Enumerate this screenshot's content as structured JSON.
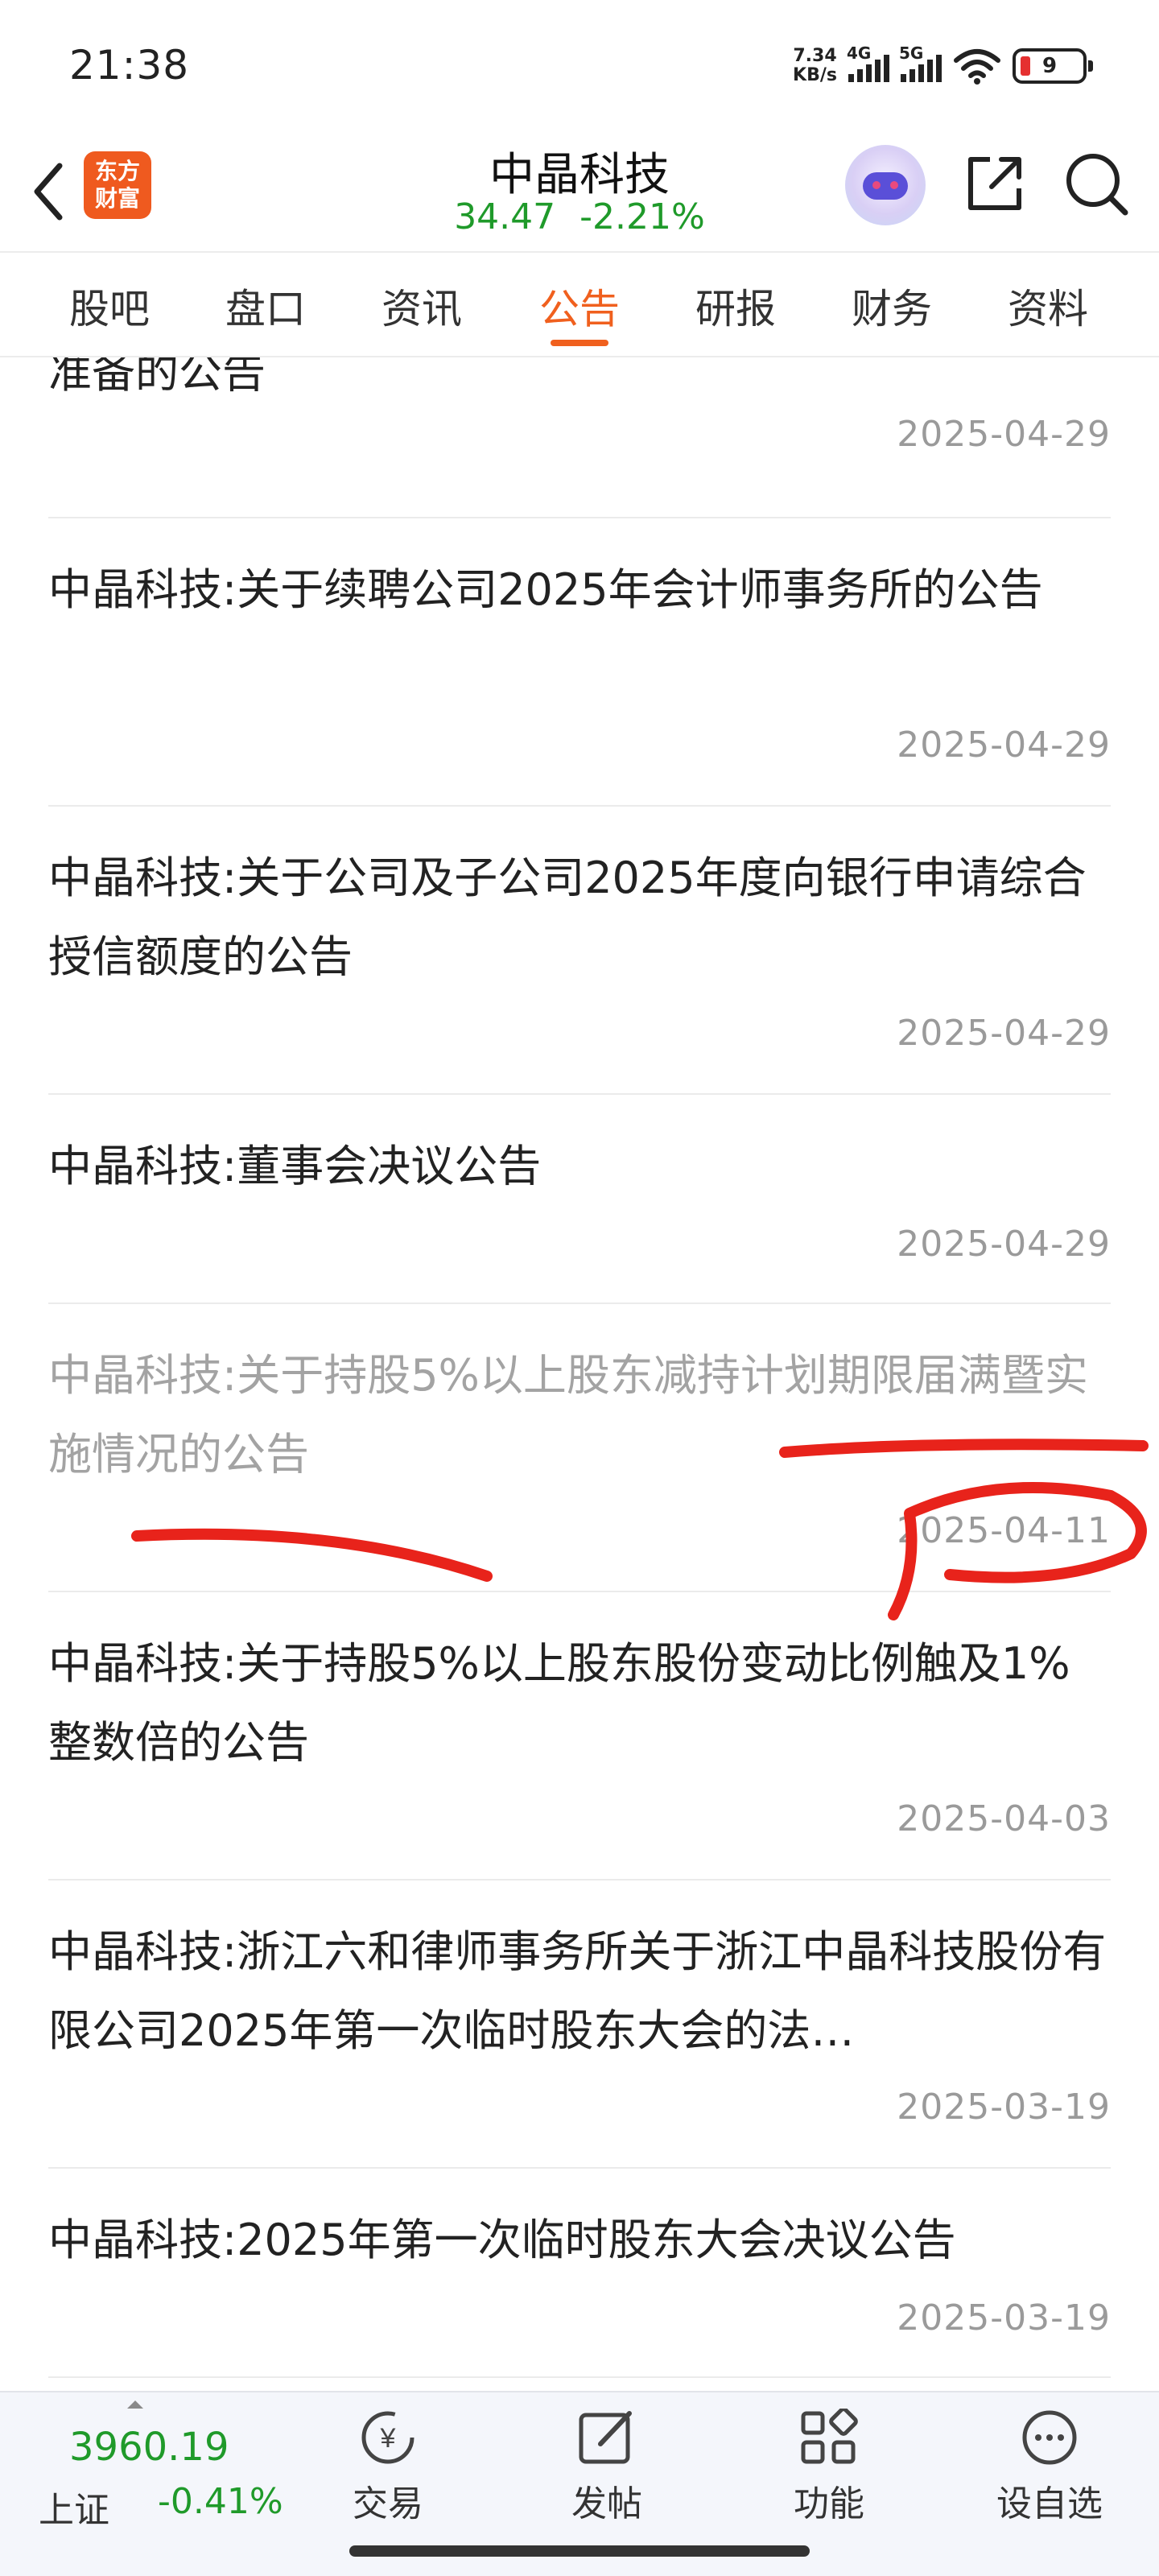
{
  "status": {
    "time": "21:38",
    "net_speed_value": "7.34",
    "net_speed_unit": "KB/s",
    "signal1_label": "4G",
    "signal2_label": "5G",
    "battery": "9"
  },
  "header": {
    "logo_line1": "东方",
    "logo_line2": "财富",
    "stock_name": "中晶科技",
    "price": "34.47",
    "change": "-2.21%"
  },
  "tabs": [
    "股吧",
    "盘口",
    "资讯",
    "公告",
    "研报",
    "财务",
    "资料"
  ],
  "active_tab": "公告",
  "announcements": [
    {
      "title": "准备的公告",
      "date": "2025-04-29",
      "read": false
    },
    {
      "title": "中晶科技:关于续聘公司2025年会计师事务所的公告",
      "date": "2025-04-29",
      "read": false
    },
    {
      "title": "中晶科技:关于公司及子公司2025年度向银行申请综合授信额度的公告",
      "date": "2025-04-29",
      "read": false
    },
    {
      "title": "中晶科技:董事会决议公告",
      "date": "2025-04-29",
      "read": false
    },
    {
      "title": "中晶科技:关于持股5%以上股东减持计划期限届满暨实施情况的公告",
      "date": "2025-04-11",
      "read": true
    },
    {
      "title": "中晶科技:关于持股5%以上股东股份变动比例触及1%整数倍的公告",
      "date": "2025-04-03",
      "read": false
    },
    {
      "title": "中晶科技:浙江六和律师事务所关于浙江中晶科技股份有限公司2025年第一次临时股东大会的法…",
      "date": "2025-03-19",
      "read": false
    },
    {
      "title": "中晶科技:2025年第一次临时股东大会决议公告",
      "date": "2025-03-19",
      "read": false
    }
  ],
  "bottom": {
    "index_value": "3960.19",
    "index_name": "上证",
    "index_change": "-0.41%",
    "trade": "交易",
    "post": "发帖",
    "functions": "功能",
    "watchlist": "设自选"
  },
  "colors": {
    "accent": "#f0601e",
    "down_green": "#1f9a2a",
    "annotation_red": "#e8231b"
  }
}
